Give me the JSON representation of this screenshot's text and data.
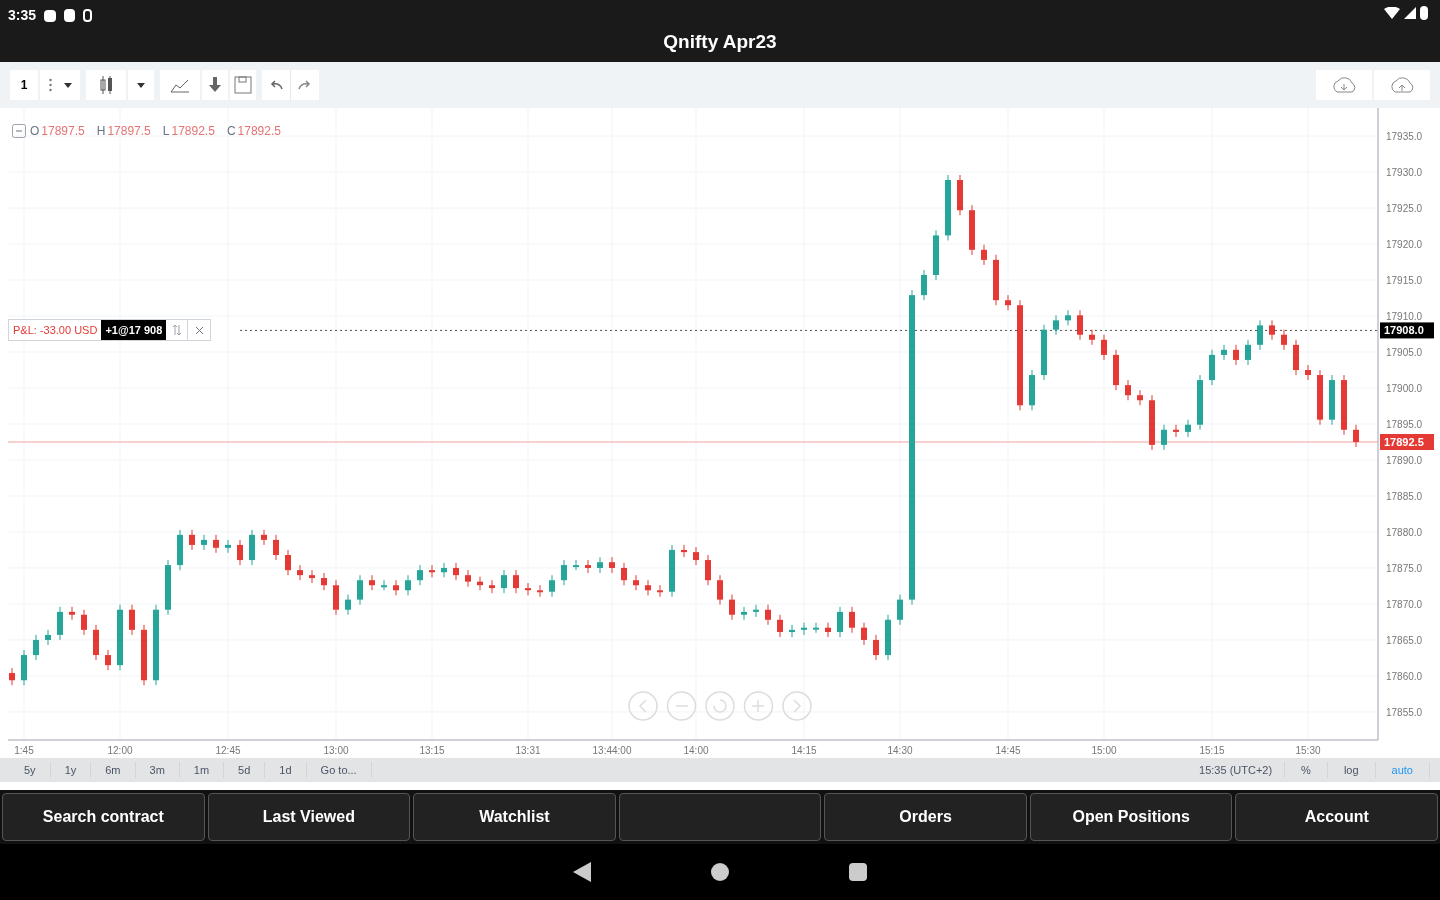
{
  "status_bar": {
    "time": "3:35"
  },
  "title": "Qnifty Apr23",
  "toolbar": {
    "interval": "1"
  },
  "legend": [
    {
      "label": "O",
      "value": "17897.5"
    },
    {
      "label": "H",
      "value": "17897.5"
    },
    {
      "label": "L",
      "value": "17892.5"
    },
    {
      "label": "C",
      "value": "17892.5"
    }
  ],
  "position": {
    "pnl": "P&L: -33.00 USD",
    "order": "+1@17 908"
  },
  "chart": {
    "chart_data": {
      "type": "candlestick",
      "grid": true,
      "ylim": [
        17851.1,
        17938.9
      ],
      "yticks": [
        {
          "value": 17935,
          "label": "17935.0"
        },
        {
          "value": 17930,
          "label": "17930.0"
        },
        {
          "value": 17925,
          "label": "17925.0"
        },
        {
          "value": 17920,
          "label": "17920.0"
        },
        {
          "value": 17915,
          "label": "17915.0"
        },
        {
          "value": 17910,
          "label": "17910.0"
        },
        {
          "value": 17905,
          "label": "17905.0"
        },
        {
          "value": 17900,
          "label": "17900.0"
        },
        {
          "value": 17895,
          "label": "17895.0"
        },
        {
          "value": 17890,
          "label": "17890.0"
        },
        {
          "value": 17885,
          "label": "17885.0"
        },
        {
          "value": 17880,
          "label": "17880.0"
        },
        {
          "value": 17875,
          "label": "17875.0"
        },
        {
          "value": 17870,
          "label": "17870.0"
        },
        {
          "value": 17865,
          "label": "17865.0"
        },
        {
          "value": 17860,
          "label": "17860.0"
        },
        {
          "value": 17855,
          "label": "17855.0"
        }
      ],
      "ref_lines": [
        {
          "axis": "y",
          "value": 17908,
          "color": "#555555",
          "label": "17908.0"
        },
        {
          "axis": "y",
          "value": 17892.5,
          "color": "#f4a0a0",
          "label": "17892.5"
        }
      ],
      "categories": [
        null,
        "1:45",
        null,
        null,
        null,
        null,
        null,
        null,
        null,
        "12:00",
        null,
        null,
        null,
        null,
        null,
        null,
        null,
        null,
        "12:45",
        null,
        null,
        null,
        null,
        null,
        null,
        null,
        null,
        "13:00",
        null,
        null,
        null,
        null,
        null,
        null,
        null,
        "13:15",
        null,
        null,
        null,
        null,
        null,
        null,
        null,
        "13:31",
        null,
        null,
        null,
        null,
        null,
        null,
        "13:44:00",
        null,
        null,
        null,
        null,
        null,
        null,
        "14:00",
        null,
        null,
        null,
        null,
        null,
        null,
        null,
        null,
        "14:15",
        null,
        null,
        null,
        null,
        null,
        null,
        null,
        "14:30",
        null,
        null,
        null,
        null,
        null,
        null,
        null,
        null,
        "14:45",
        null,
        null,
        null,
        null,
        null,
        null,
        null,
        "15:00",
        null,
        null,
        null,
        null,
        null,
        null,
        null,
        null,
        "15:15",
        null,
        null,
        null,
        null,
        null,
        null,
        null,
        "15:30",
        null,
        null,
        null,
        null
      ],
      "ohlc": [
        [
          17860.4,
          17861.1,
          17858.7,
          17859.4
        ],
        [
          17859.4,
          17863.6,
          17858.7,
          17862.9
        ],
        [
          17862.9,
          17865.7,
          17862.2,
          17865
        ],
        [
          17865,
          17866.4,
          17864.3,
          17865.7
        ],
        [
          17865.7,
          17869.6,
          17865,
          17868.9
        ],
        [
          17868.9,
          17869.6,
          17867.8,
          17868.5
        ],
        [
          17868.5,
          17869.2,
          17865.7,
          17866.4
        ],
        [
          17866.4,
          17867.1,
          17862.2,
          17862.9
        ],
        [
          17862.9,
          17863.6,
          17860.8,
          17861.5
        ],
        [
          17861.5,
          17869.9,
          17860.8,
          17869.2
        ],
        [
          17869.2,
          17869.9,
          17865.7,
          17866.4
        ],
        [
          17866.4,
          17867.1,
          17858.7,
          17859.4
        ],
        [
          17859.4,
          17869.9,
          17858.7,
          17869.2
        ],
        [
          17869.2,
          17876.1,
          17868.5,
          17875.4
        ],
        [
          17875.4,
          17880.3,
          17874.7,
          17879.6
        ],
        [
          17879.6,
          17880.3,
          17877.5,
          17878.2
        ],
        [
          17878.2,
          17879.6,
          17877.5,
          17878.9
        ],
        [
          17878.9,
          17879.6,
          17877.1,
          17877.8
        ],
        [
          17877.8,
          17878.9,
          17877.1,
          17878.2
        ],
        [
          17878.2,
          17878.9,
          17875.4,
          17876.1
        ],
        [
          17876.1,
          17880.3,
          17875.4,
          17879.6
        ],
        [
          17879.6,
          17880.3,
          17878.2,
          17878.9
        ],
        [
          17878.9,
          17879.6,
          17876.1,
          17876.8
        ],
        [
          17876.8,
          17877.5,
          17874,
          17874.7
        ],
        [
          17874.7,
          17875.4,
          17873.3,
          17874
        ],
        [
          17874,
          17874.7,
          17872.9,
          17873.6
        ],
        [
          17873.6,
          17874.3,
          17871.9,
          17872.6
        ],
        [
          17872.6,
          17873.3,
          17868.5,
          17869.2
        ],
        [
          17869.2,
          17871.3,
          17868.5,
          17870.6
        ],
        [
          17870.6,
          17874,
          17869.9,
          17873.3
        ],
        [
          17873.3,
          17874,
          17871.9,
          17872.6
        ],
        [
          17872.6,
          17873.3,
          17871.9,
          17872.6
        ],
        [
          17872.6,
          17873.3,
          17871.2,
          17871.9
        ],
        [
          17871.9,
          17874,
          17871.2,
          17873.3
        ],
        [
          17873.3,
          17875.4,
          17872.6,
          17874.7
        ],
        [
          17874.7,
          17875.4,
          17873.7,
          17874.4
        ],
        [
          17874.4,
          17875.7,
          17873.7,
          17875
        ],
        [
          17875,
          17875.7,
          17873.3,
          17874
        ],
        [
          17874,
          17874.7,
          17872.4,
          17873.1
        ],
        [
          17873.1,
          17873.8,
          17871.9,
          17872.6
        ],
        [
          17872.6,
          17873.3,
          17871.5,
          17872.2
        ],
        [
          17872.2,
          17874.7,
          17871.5,
          17874
        ],
        [
          17874,
          17874.7,
          17871.5,
          17872.2
        ],
        [
          17872.2,
          17872.9,
          17871.2,
          17871.9
        ],
        [
          17871.9,
          17872.6,
          17871,
          17871.7
        ],
        [
          17871.7,
          17874,
          17871,
          17873.3
        ],
        [
          17873.3,
          17876.1,
          17872.6,
          17875.4
        ],
        [
          17875.4,
          17876.1,
          17874.7,
          17875.4
        ],
        [
          17875.4,
          17876.1,
          17874.3,
          17875
        ],
        [
          17875,
          17876.5,
          17874.3,
          17875.8
        ],
        [
          17875.8,
          17876.5,
          17874.3,
          17875
        ],
        [
          17875,
          17875.7,
          17872.6,
          17873.3
        ],
        [
          17873.3,
          17874,
          17871.9,
          17872.6
        ],
        [
          17872.6,
          17873.3,
          17871.2,
          17871.9
        ],
        [
          17871.9,
          17872.6,
          17871,
          17871.7
        ],
        [
          17871.7,
          17878.2,
          17871,
          17877.5
        ],
        [
          17877.5,
          17878.2,
          17876.5,
          17877.2
        ],
        [
          17877.2,
          17877.9,
          17875.4,
          17876.1
        ],
        [
          17876.1,
          17876.8,
          17872.6,
          17873.3
        ],
        [
          17873.3,
          17874,
          17869.9,
          17870.6
        ],
        [
          17870.6,
          17871.3,
          17867.8,
          17868.5
        ],
        [
          17868.5,
          17869.6,
          17867.8,
          17868.9
        ],
        [
          17868.9,
          17869.9,
          17868.2,
          17869.2
        ],
        [
          17869.2,
          17869.9,
          17867.1,
          17867.8
        ],
        [
          17867.8,
          17868.5,
          17865.4,
          17866.1
        ],
        [
          17866.1,
          17867.1,
          17865.4,
          17866.4
        ],
        [
          17866.4,
          17867.4,
          17865.7,
          17866.7
        ],
        [
          17866.7,
          17867.4,
          17866,
          17866.7
        ],
        [
          17866.7,
          17867.4,
          17865.4,
          17866.1
        ],
        [
          17866.1,
          17869.6,
          17865.4,
          17868.9
        ],
        [
          17868.9,
          17869.6,
          17866,
          17866.7
        ],
        [
          17866.7,
          17867.4,
          17864.3,
          17865
        ],
        [
          17865,
          17865.7,
          17862.2,
          17862.9
        ],
        [
          17862.9,
          17868.5,
          17862.2,
          17867.8
        ],
        [
          17867.8,
          17871.3,
          17867.1,
          17870.6
        ],
        [
          17870.6,
          17913.6,
          17869.9,
          17912.9
        ],
        [
          17912.9,
          17916.4,
          17912.2,
          17915.7
        ],
        [
          17915.7,
          17921.9,
          17915,
          17921.2
        ],
        [
          17921.2,
          17929.6,
          17920.5,
          17928.9
        ],
        [
          17928.9,
          17929.6,
          17924,
          17924.7
        ],
        [
          17924.7,
          17925.4,
          17918.5,
          17919.2
        ],
        [
          17919.2,
          17919.9,
          17917.1,
          17917.8
        ],
        [
          17917.8,
          17918.5,
          17911.5,
          17912.2
        ],
        [
          17912.2,
          17912.9,
          17910.8,
          17911.5
        ],
        [
          17911.5,
          17912.2,
          17896.9,
          17897.6
        ],
        [
          17897.6,
          17902.5,
          17896.9,
          17901.8
        ],
        [
          17901.8,
          17908.8,
          17901.1,
          17908.1
        ],
        [
          17908.1,
          17910.1,
          17907.4,
          17909.4
        ],
        [
          17909.4,
          17910.8,
          17908.7,
          17910.1
        ],
        [
          17910.1,
          17910.8,
          17906.7,
          17907.4
        ],
        [
          17907.4,
          17908.1,
          17906,
          17906.7
        ],
        [
          17906.7,
          17907.4,
          17903.9,
          17904.6
        ],
        [
          17904.6,
          17905.3,
          17899.7,
          17900.4
        ],
        [
          17900.4,
          17901.1,
          17898.3,
          17899
        ],
        [
          17899,
          17899.7,
          17897.6,
          17898.3
        ],
        [
          17898.3,
          17899,
          17891.4,
          17892.1
        ],
        [
          17892.1,
          17894.9,
          17891.4,
          17894.2
        ],
        [
          17894.2,
          17894.9,
          17893.2,
          17893.9
        ],
        [
          17893.9,
          17895.6,
          17893.2,
          17894.9
        ],
        [
          17894.9,
          17901.8,
          17894.2,
          17901.1
        ],
        [
          17901.1,
          17905.3,
          17900.4,
          17904.6
        ],
        [
          17904.6,
          17906,
          17903.9,
          17905.3
        ],
        [
          17905.3,
          17906,
          17903.2,
          17903.9
        ],
        [
          17903.9,
          17906.7,
          17903.2,
          17906
        ],
        [
          17906,
          17909.4,
          17905.3,
          17908.7
        ],
        [
          17908.7,
          17909.4,
          17906.7,
          17907.4
        ],
        [
          17907.4,
          17908.1,
          17905.3,
          17906
        ],
        [
          17906,
          17906.7,
          17901.8,
          17902.5
        ],
        [
          17902.5,
          17903.2,
          17901.1,
          17901.8
        ],
        [
          17901.8,
          17902.5,
          17894.9,
          17895.6
        ],
        [
          17895.6,
          17901.8,
          17894.9,
          17901.1
        ],
        [
          17901.1,
          17901.8,
          17893.5,
          17894.2
        ],
        [
          17894.2,
          17894.9,
          17891.8,
          17892.5
        ]
      ]
    }
  },
  "ranges": [
    "5y",
    "1y",
    "6m",
    "3m",
    "1m",
    "5d",
    "1d",
    "Go to..."
  ],
  "chart_footer": {
    "timezone": "15:35 (UTC+2)",
    "options": [
      {
        "label": "%",
        "selected": false
      },
      {
        "label": "log",
        "selected": false
      },
      {
        "label": "auto",
        "selected": true
      }
    ]
  },
  "tabs": [
    {
      "kind": "button",
      "label": "Search contract"
    },
    {
      "kind": "button",
      "label": "Last Viewed"
    },
    {
      "kind": "button",
      "label": "Watchlist"
    },
    {
      "kind": "blank"
    },
    {
      "kind": "button",
      "label": "Orders"
    },
    {
      "kind": "button",
      "label": "Open Positions"
    },
    {
      "kind": "button",
      "label": "Account"
    }
  ]
}
